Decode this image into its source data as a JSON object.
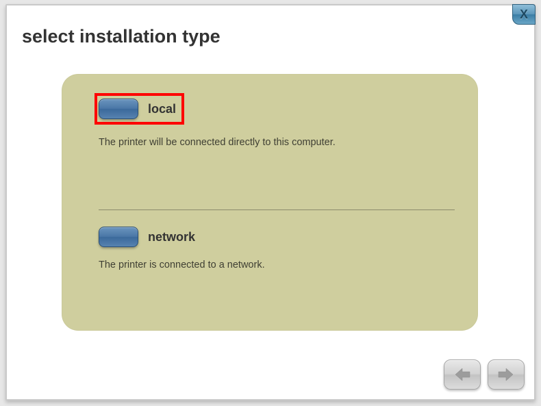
{
  "window": {
    "close_label": "X",
    "title": "select installation type"
  },
  "panel": {
    "options": [
      {
        "label": "local",
        "description": "The printer will be connected directly to this computer.",
        "highlighted": true
      },
      {
        "label": "network",
        "description": "The printer is connected to a network.",
        "highlighted": false
      }
    ]
  },
  "nav": {
    "back_icon": "arrow-left",
    "forward_icon": "arrow-right"
  },
  "colors": {
    "panel_bg": "#cfce9e",
    "button_blue": "#4a77a7",
    "highlight_border": "#ff0000"
  }
}
